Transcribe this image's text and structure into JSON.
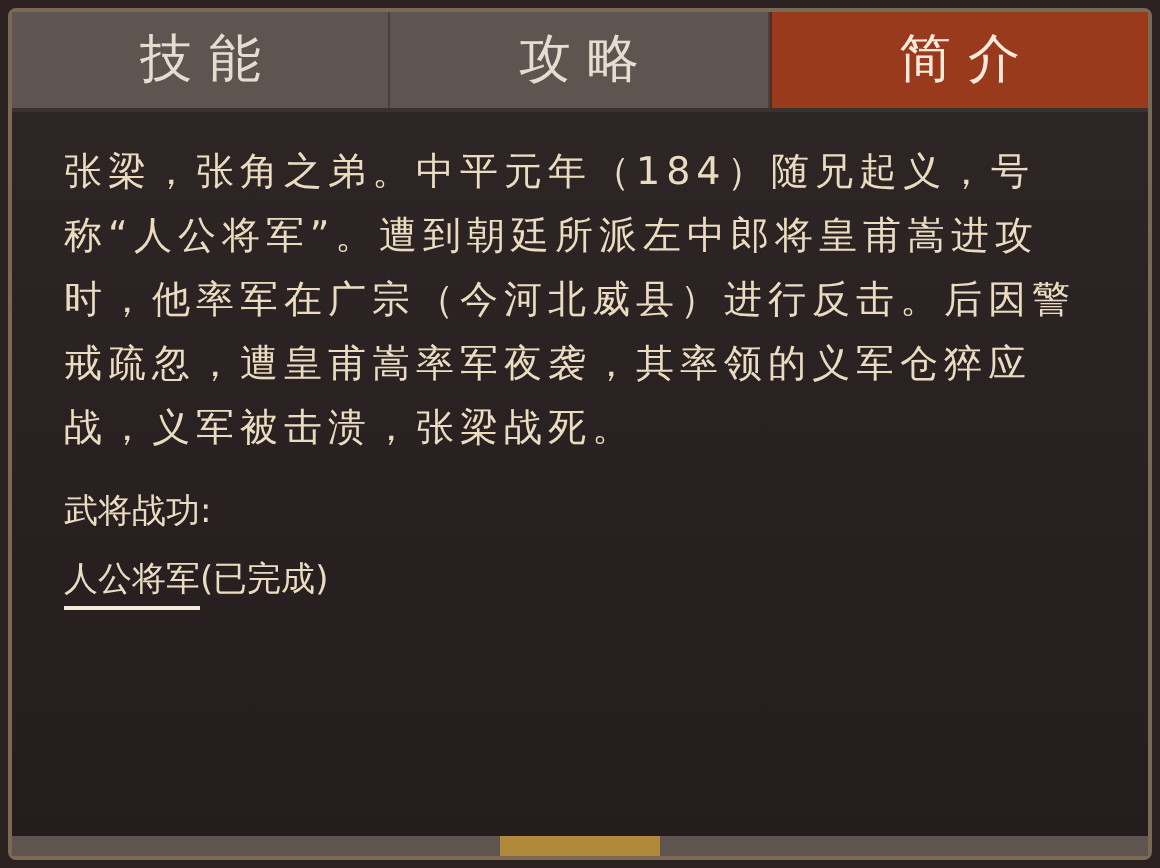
{
  "tabs": [
    {
      "label": "技 能",
      "selected": false
    },
    {
      "label": "攻 略",
      "selected": false
    },
    {
      "label": "简 介",
      "selected": true
    }
  ],
  "biography": "张梁，张角之弟。中平元年（184）随兄起义，号称“人公将军”。遭到朝廷所派左中郎将皇甫嵩进攻时，他率军在广宗（今河北威县）进行反击。后因警戒疏忽，遭皇甫嵩率军夜袭，其率领的义军仓猝应战，义军被击溃，张梁战死。",
  "achievements": {
    "heading": "武将战功:",
    "items": [
      {
        "title": "人公将军",
        "status": "(已完成)"
      }
    ]
  }
}
